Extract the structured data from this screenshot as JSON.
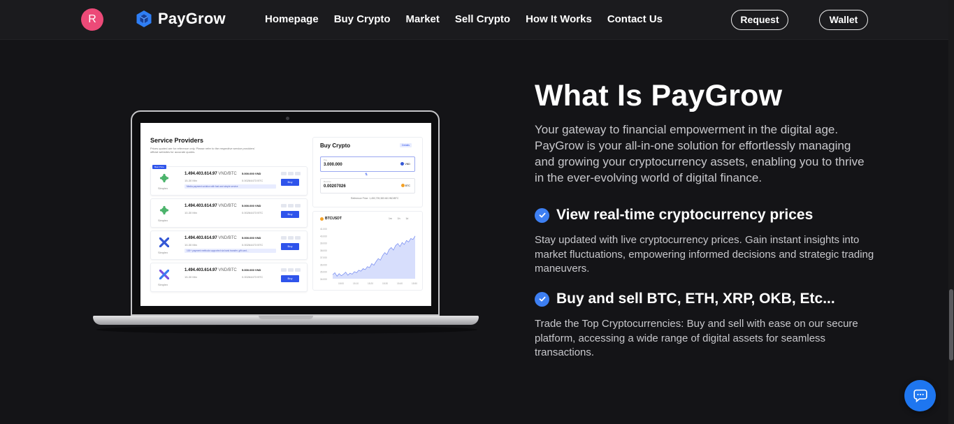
{
  "header": {
    "avatar_initial": "R",
    "brand": "PayGrow",
    "nav": [
      "Homepage",
      "Buy Crypto",
      "Market",
      "Sell Crypto",
      "How It Works",
      "Contact Us"
    ],
    "request_label": "Request",
    "wallet_label": "Wallet"
  },
  "colors": {
    "accent": "#3d7ff2",
    "avatar": "#ec4a78",
    "background": "#141417"
  },
  "about": {
    "title": "What Is PayGrow",
    "lead": "Your gateway to financial empowerment in the digital age. PayGrow is your all-in-one solution for effortlessly managing and growing your cryptocurrency assets, enabling you to thrive in the ever-evolving world of digital finance.",
    "features": [
      {
        "title": "View real-time cryptocurrency prices",
        "description": "Stay updated with live cryptocurrency prices. Gain instant insights into market fluctuations, empowering informed decisions and strategic trading maneuvers."
      },
      {
        "title": "Buy and sell BTC, ETH, XRP, OKB, Etc...",
        "description": "Trade the Top Cryptocurrencies: Buy and sell with ease on our secure platform, accessing a wide range of digital assets for seamless transactions."
      }
    ]
  },
  "mockup": {
    "providers_title": "Service Providers",
    "providers_desc": "Prices quoted are for reference only. Please refer to the respective service providers' official websites for accurate quotes.",
    "best_tag": "Best Price",
    "providers": [
      {
        "name": "Simplex",
        "logo": "green",
        "price": "1.494.403.614.97",
        "unit": "VND/BTC",
        "time": "15-30 Min",
        "limit": "5.000.000 VND",
        "amount": "0.00264473 BTC",
        "note": "Media payment solution with fast and simple service",
        "buy": "Buy"
      },
      {
        "name": "Simplex",
        "logo": "green",
        "price": "1.494.403.614.97",
        "unit": "VND/BTC",
        "time": "10-30 Min",
        "limit": "5.000.000 VND",
        "amount": "0.00264473 BTC",
        "note": "",
        "buy": "Buy"
      },
      {
        "name": "Simplex",
        "logo": "x-blue",
        "price": "1.494.403.614.97",
        "unit": "VND/BTC",
        "time": "10-30 Min",
        "limit": "5.000.000 VND",
        "amount": "0.00264473 BTC",
        "note": "100+ payment methods supported via bank transfer, gift card...",
        "buy": "Buy"
      },
      {
        "name": "Simplex",
        "logo": "x-purple",
        "price": "1.494.403.614.97",
        "unit": "VND/BTC",
        "time": "15-30 Min",
        "limit": "5.000.000 VND",
        "amount": "0.00264473 BTC",
        "note": "",
        "buy": "Buy"
      }
    ],
    "buy": {
      "title": "Buy Crypto",
      "badge": "Details",
      "pay_label": "Pay",
      "pay_value": "3.000.000",
      "pay_currency": "VND",
      "receive_label": "Receive",
      "receive_value": "0.00207026",
      "receive_currency": "BTC",
      "reference": "Reference Price: 1,450,739,383.66 VND/BTC"
    },
    "chart": {
      "symbol": "BTCUSDT",
      "periods": [
        "1m",
        "1h",
        "1d"
      ]
    }
  },
  "chart_data": {
    "type": "area",
    "series": [
      {
        "values": [
          0.08,
          0.12,
          0.05,
          0.1,
          0.06,
          0.09,
          0.13,
          0.07,
          0.11,
          0.09,
          0.14,
          0.12,
          0.17,
          0.15,
          0.2,
          0.18,
          0.24,
          0.22,
          0.3,
          0.27,
          0.34,
          0.4,
          0.37,
          0.46,
          0.52,
          0.48,
          0.58,
          0.62,
          0.57,
          0.66,
          0.7,
          0.64,
          0.72,
          0.68,
          0.76,
          0.73,
          0.8,
          0.78,
          0.85
        ]
      }
    ],
    "x_ticks": [
      "15:00",
      "15:10",
      "15:20",
      "15:30",
      "15:40",
      "15:50"
    ],
    "y_ticks": [
      "41.000",
      "40.000",
      "39.000",
      "38.000",
      "37.000",
      "36.000",
      "35.000",
      "34.000"
    ],
    "grid": false
  }
}
